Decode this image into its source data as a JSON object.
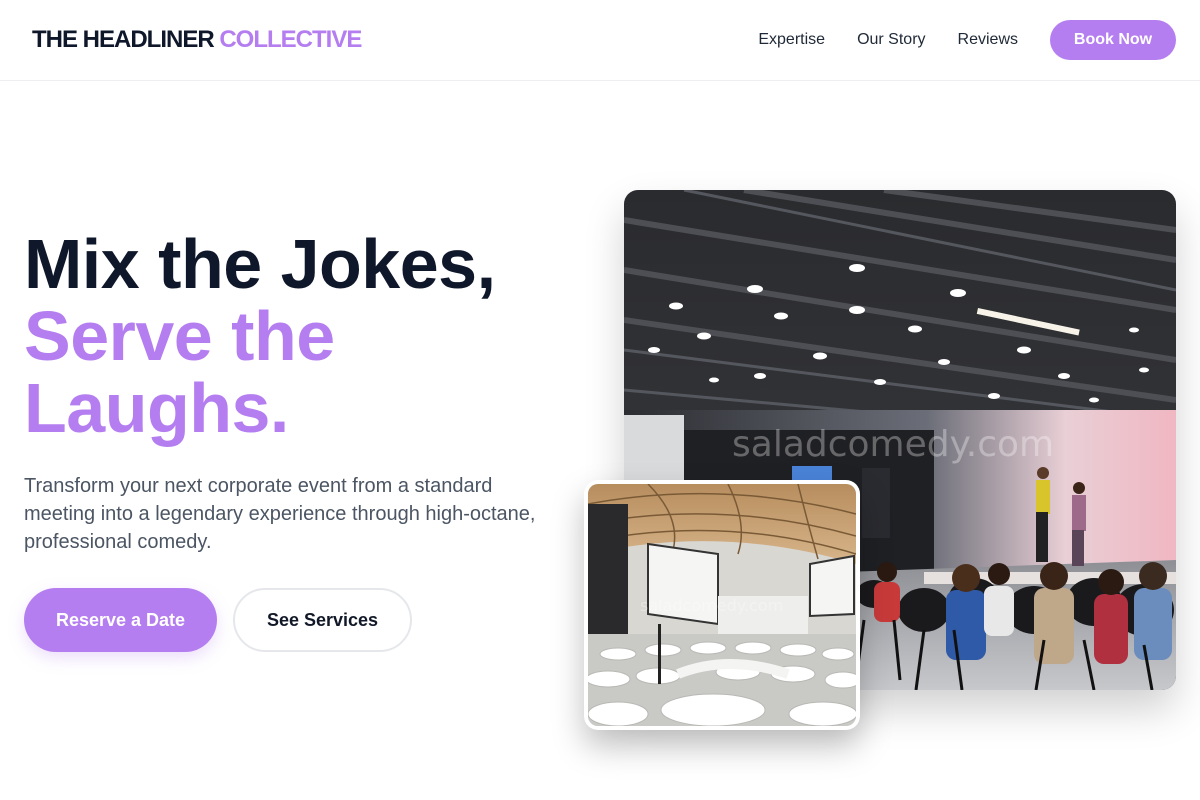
{
  "brand": {
    "name_dark": "THE HEADLINER",
    "name_accent": "COLLECTIVE"
  },
  "nav": {
    "links": [
      "Expertise",
      "Our Story",
      "Reviews"
    ],
    "cta": "Book Now"
  },
  "hero": {
    "headline_line1": "Mix the Jokes,",
    "headline_line2": "Serve the",
    "headline_line3": "Laughs.",
    "subtitle": "Transform your next corporate event from a standard meeting into a legendary experience through high-octane, professional comedy.",
    "primary_cta": "Reserve a Date",
    "secondary_cta": "See Services"
  },
  "images": {
    "main_watermark": "saladcomedy.com",
    "small_watermark": "saladcomedy.com"
  },
  "colors": {
    "accent": "#b57ef0",
    "heading": "#0f172a",
    "body_text": "#4b5563"
  }
}
